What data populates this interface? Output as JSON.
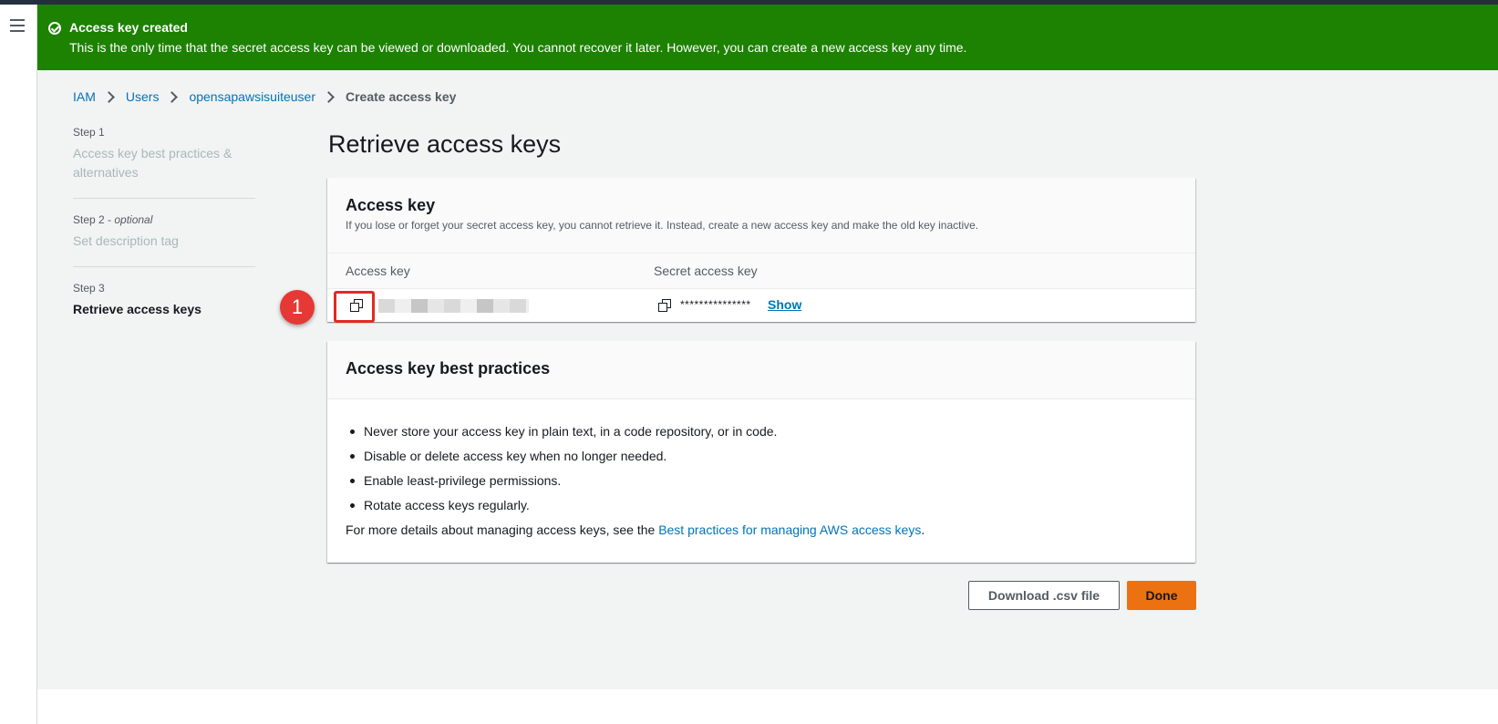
{
  "flash": {
    "title": "Access key created",
    "message": "This is the only time that the secret access key can be viewed or downloaded. You cannot recover it later. However, you can create a new access key any time."
  },
  "breadcrumb": {
    "items": [
      "IAM",
      "Users",
      "opensapawsisuiteuser"
    ],
    "current": "Create access key"
  },
  "steps": [
    {
      "label": "Step 1",
      "title": "Access key best practices & alternatives"
    },
    {
      "label": "Step 2 - ",
      "optional": "optional",
      "title": "Set description tag"
    },
    {
      "label": "Step 3",
      "title": "Retrieve access keys"
    }
  ],
  "page_title": "Retrieve access keys",
  "access_key_panel": {
    "heading": "Access key",
    "description": "If you lose or forget your secret access key, you cannot retrieve it. Instead, create a new access key and make the old key inactive.",
    "col_access_key": "Access key",
    "col_secret": "Secret access key",
    "secret_masked": "***************",
    "show_label": "Show"
  },
  "annotation": {
    "number": "1"
  },
  "best_practices": {
    "heading": "Access key best practices",
    "items": [
      "Never store your access key in plain text, in a code repository, or in code.",
      "Disable or delete access key when no longer needed.",
      "Enable least-privilege permissions.",
      "Rotate access keys regularly."
    ],
    "more_prefix": "For more details about managing access keys, see the ",
    "more_link": "Best practices for managing AWS access keys",
    "more_suffix": "."
  },
  "buttons": {
    "download": "Download .csv file",
    "done": "Done"
  },
  "colors": {
    "success": "#1d8102",
    "primary": "#ec7211",
    "link": "#0073bb",
    "annotation": "#e53935"
  }
}
